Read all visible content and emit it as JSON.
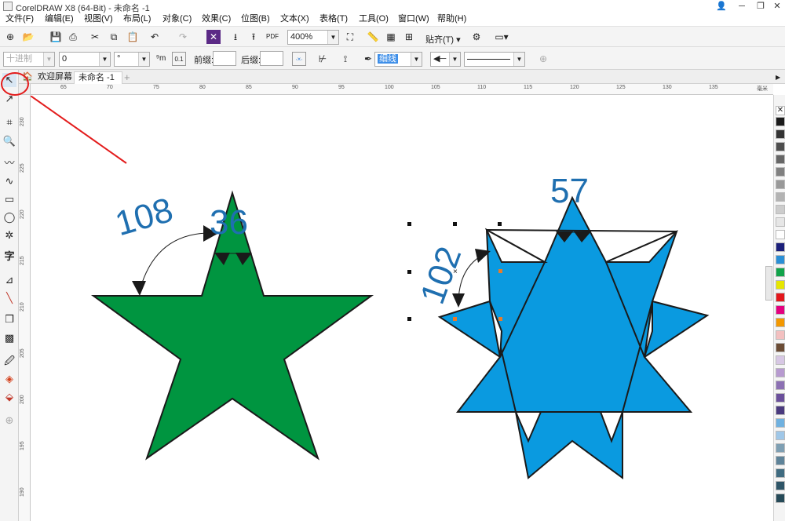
{
  "window": {
    "title": "CorelDRAW X8 (64-Bit) - 未命名 -1",
    "min": "─",
    "max": "❐",
    "close": "✕",
    "profile": "👤"
  },
  "menu": [
    "文件(F)",
    "编辑(E)",
    "视图(V)",
    "布局(L)",
    "对象(C)",
    "效果(C)",
    "位图(B)",
    "文本(X)",
    "表格(T)",
    "工具(O)",
    "窗口(W)",
    "帮助(H)"
  ],
  "toolbar": {
    "zoom": "400%",
    "snap": "贴齐(T)",
    "pdf_label": "PDF"
  },
  "propbar": {
    "unit_placeholder": "十进制",
    "angle_value": "0",
    "degree_symbol": "°",
    "prefix_label": "前缀:",
    "suffix_label": "后缀:",
    "outline_width": "细线",
    "prefix_value": "",
    "suffix_value": ""
  },
  "tabs": {
    "home_icon": "home-icon",
    "welcome": "欢迎屏幕",
    "document": "未命名 -1",
    "add": "+"
  },
  "ruler": {
    "h_labels": [
      "65",
      "70",
      "75",
      "80",
      "85",
      "90",
      "95",
      "100",
      "105",
      "110",
      "115",
      "120",
      "125",
      "130",
      "135"
    ],
    "h_unit": "毫米",
    "v_labels": [
      "230",
      "225",
      "220",
      "215",
      "210",
      "205",
      "200",
      "195",
      "190"
    ]
  },
  "palette_colors": [
    "#1a1a1a",
    "#333333",
    "#4d4d4d",
    "#666666",
    "#808080",
    "#999999",
    "#b3b3b3",
    "#cccccc",
    "#e6e6e6",
    "#ffffff",
    "#1b1f7a",
    "#2a8fd6",
    "#11a34a",
    "#e6e600",
    "#e3171c",
    "#e4007f",
    "#f39800",
    "#f3c0c0",
    "#6b4c35",
    "#d7c7e4",
    "#b79ad0",
    "#8c70b3",
    "#6a4f9b",
    "#4a3a7e",
    "#6fb1e0",
    "#9fc7e8",
    "#7e9fb3",
    "#5e8399",
    "#3f6b80",
    "#2e5567",
    "#264a58"
  ],
  "canvas": {
    "green_star_color": "#009540",
    "blue_star_color": "#0a9ae0",
    "label_108": "108",
    "label_36": "36",
    "label_102": "102",
    "label_57": "57",
    "annotation_color": "#e31c1c"
  }
}
